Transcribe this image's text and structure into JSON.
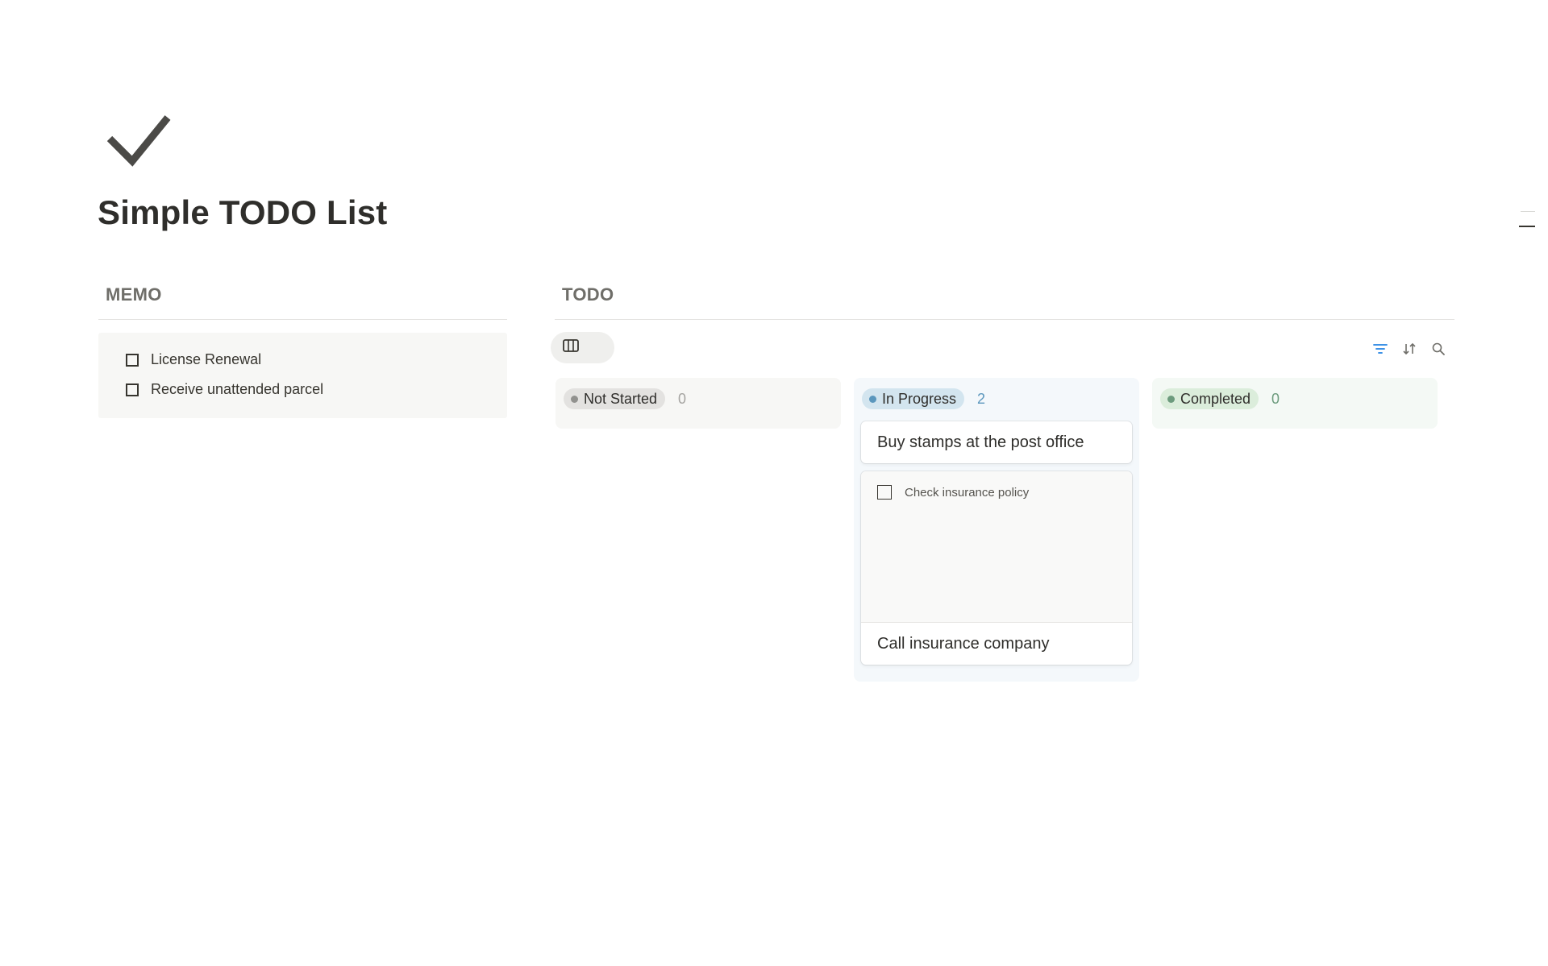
{
  "page": {
    "icon": "checkmark-icon",
    "title": "Simple TODO List"
  },
  "memo": {
    "heading": "MEMO",
    "items": [
      {
        "label": "License Renewal",
        "checked": false
      },
      {
        "label": "Receive unattended parcel",
        "checked": false
      }
    ]
  },
  "todo": {
    "heading": "TODO",
    "view_icon": "board-view-icon",
    "toolbar_icons": [
      "filter-icon",
      "sort-icon",
      "search-icon"
    ],
    "columns": [
      {
        "status": "Not Started",
        "count": "0",
        "pill_color": "#e3e2e0",
        "dot_color": "#91918e",
        "count_color": "#a5a4a1",
        "cards": []
      },
      {
        "status": "In Progress",
        "count": "2",
        "pill_color": "#d3e5ef",
        "dot_color": "#5b97bd",
        "count_color": "#5b97bd",
        "cards": [
          {
            "title": "Buy stamps at the post office"
          },
          {
            "title": "Call insurance company",
            "preview_item": "Check insurance policy"
          }
        ]
      },
      {
        "status": "Completed",
        "count": "0",
        "pill_color": "#dbeddb",
        "dot_color": "#6c9b7d",
        "count_color": "#6c9b7d",
        "cards": []
      }
    ]
  },
  "colors": {
    "accent": "#2383e2",
    "text": "#37352f"
  }
}
